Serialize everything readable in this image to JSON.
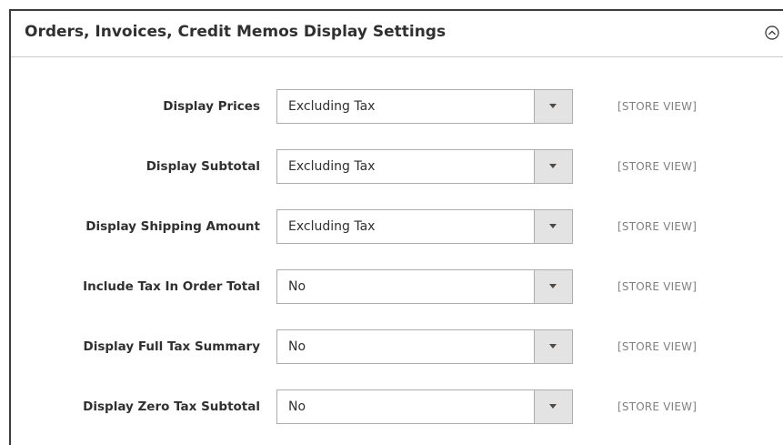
{
  "section": {
    "title": "Orders, Invoices, Credit Memos Display Settings",
    "collapse_icon": "chevron-up-circle-icon"
  },
  "rows": [
    {
      "label": "Display Prices",
      "value": "Excluding Tax",
      "scope": "[STORE VIEW]"
    },
    {
      "label": "Display Subtotal",
      "value": "Excluding Tax",
      "scope": "[STORE VIEW]"
    },
    {
      "label": "Display Shipping Amount",
      "value": "Excluding Tax",
      "scope": "[STORE VIEW]"
    },
    {
      "label": "Include Tax In Order Total",
      "value": "No",
      "scope": "[STORE VIEW]"
    },
    {
      "label": "Display Full Tax Summary",
      "value": "No",
      "scope": "[STORE VIEW]"
    },
    {
      "label": "Display Zero Tax Subtotal",
      "value": "No",
      "scope": "[STORE VIEW]"
    }
  ],
  "colors": {
    "text": "#303030",
    "scope_text": "#808080",
    "select_border": "#adadad",
    "select_arrow_bg": "#e3e3e3",
    "panel_border": "#3d3d3d"
  }
}
